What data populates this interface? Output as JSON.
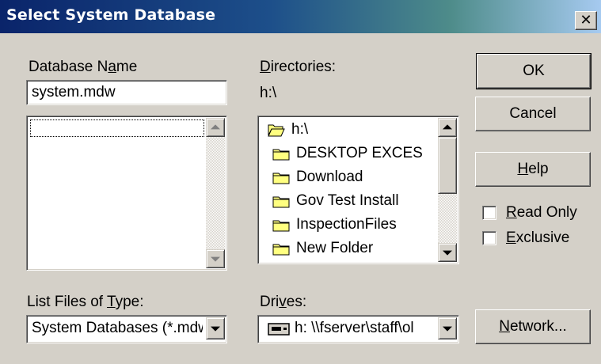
{
  "window": {
    "title": "Select System Database",
    "close_label": "✕"
  },
  "database_name": {
    "label_pre": "Database N",
    "label_key": "a",
    "label_post": "me",
    "value": "system.mdw",
    "files": []
  },
  "directories": {
    "label_key": "D",
    "label_post": "irectories:",
    "current_path": "h:\\",
    "items": [
      {
        "label": "h:\\",
        "icon": "open-folder-icon"
      },
      {
        "label": "DESKTOP EXCES",
        "icon": "folder-icon"
      },
      {
        "label": "Download",
        "icon": "folder-icon"
      },
      {
        "label": "Gov Test Install",
        "icon": "folder-icon"
      },
      {
        "label": "InspectionFiles",
        "icon": "folder-icon"
      },
      {
        "label": "New Folder",
        "icon": "folder-icon"
      }
    ]
  },
  "file_type": {
    "label_pre": "List Files of ",
    "label_key": "T",
    "label_post": "ype:",
    "selected": "System Databases (*.mdw)"
  },
  "drives": {
    "label_pre": "Dri",
    "label_key": "v",
    "label_post": "es:",
    "selected": "h: \\\\fserver\\staff\\ol"
  },
  "buttons": {
    "ok": "OK",
    "cancel": "Cancel",
    "help_key": "H",
    "help_post": "elp",
    "network_key": "N",
    "network_post": "etwork..."
  },
  "options": {
    "read_only_key": "R",
    "read_only_post": "ead Only",
    "read_only_checked": false,
    "exclusive_key": "E",
    "exclusive_post": "xclusive",
    "exclusive_checked": false
  },
  "colors": {
    "title_gradient_start": "#0a246a",
    "title_gradient_end": "#a6caf0",
    "face": "#d4d0c8",
    "folder_yellow": "#ffff80"
  }
}
